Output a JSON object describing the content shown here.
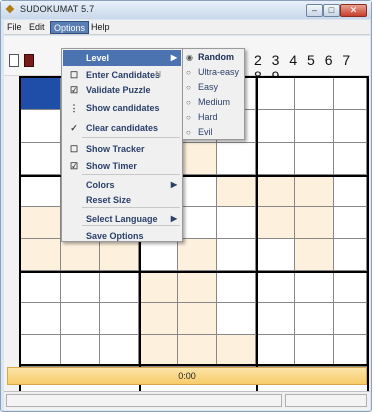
{
  "window": {
    "title": "SUDOKUMAT 5.7",
    "minimize": "–",
    "maximize": "□",
    "close": "✕"
  },
  "menubar": [
    {
      "label": "File"
    },
    {
      "label": "Edit"
    },
    {
      "label": "Options"
    },
    {
      "label": "Help"
    }
  ],
  "toolbar": {
    "digits": "2 3 4 5 6 7 8 9"
  },
  "options_menu": [
    {
      "label": "Level",
      "has_submenu": true,
      "highlighted": true,
      "mark": ""
    },
    {
      "label": "Enter Candidates",
      "accel": "N",
      "mark": "☐"
    },
    {
      "label": "Validate Puzzle",
      "mark": "☑"
    },
    {
      "label": "Show candidates",
      "mark": "⋮"
    },
    {
      "label": "Clear candidates",
      "mark": "✓"
    },
    {
      "label": "Show Tracker",
      "mark": "☐"
    },
    {
      "label": "Show Timer",
      "mark": "☑"
    },
    {
      "label": "Colors",
      "has_submenu": true,
      "mark": ""
    },
    {
      "label": "Reset Size",
      "mark": ""
    },
    {
      "label": "Select Language",
      "has_submenu": true,
      "mark": ""
    },
    {
      "label": "Save Options",
      "mark": ""
    }
  ],
  "level_submenu": [
    {
      "label": "Random",
      "checked": true
    },
    {
      "label": "Ultra-easy",
      "checked": false
    },
    {
      "label": "Easy",
      "checked": false
    },
    {
      "label": "Medium",
      "checked": false
    },
    {
      "label": "Hard",
      "checked": false
    },
    {
      "label": "Evil",
      "checked": false
    }
  ],
  "timer": {
    "value": "0:00"
  },
  "colors": {
    "accent": "#4a73b0",
    "peach": "#fdf0dc",
    "selected_cell": "#1f4ea8",
    "timer_bar": "#f7cc6a"
  }
}
